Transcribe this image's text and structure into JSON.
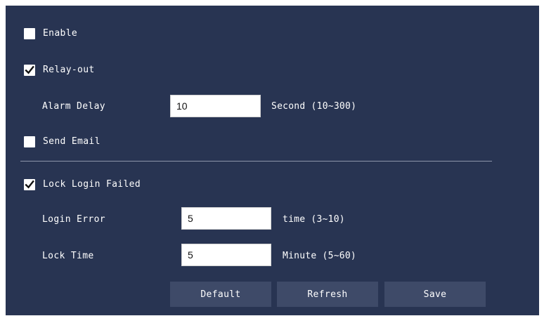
{
  "form": {
    "enable": {
      "label": "Enable",
      "checked": false
    },
    "relay_out": {
      "label": "Relay-out",
      "checked": true
    },
    "alarm_delay": {
      "label": "Alarm Delay",
      "value": "10",
      "unit": "Second (10~300)"
    },
    "send_email": {
      "label": "Send Email",
      "checked": false
    },
    "lock_login_failed": {
      "label": "Lock Login Failed",
      "checked": true
    },
    "login_error": {
      "label": "Login Error",
      "value": "5",
      "unit": "time (3~10)"
    },
    "lock_time": {
      "label": "Lock Time",
      "value": "5",
      "unit": "Minute (5~60)"
    }
  },
  "buttons": {
    "default_label": "Default",
    "refresh_label": "Refresh",
    "save_label": "Save"
  },
  "icons": {
    "checkmark": "checkmark-icon"
  },
  "colors": {
    "panel_background": "#283452",
    "button_background": "#3e4a68",
    "text": "#ffffff"
  }
}
